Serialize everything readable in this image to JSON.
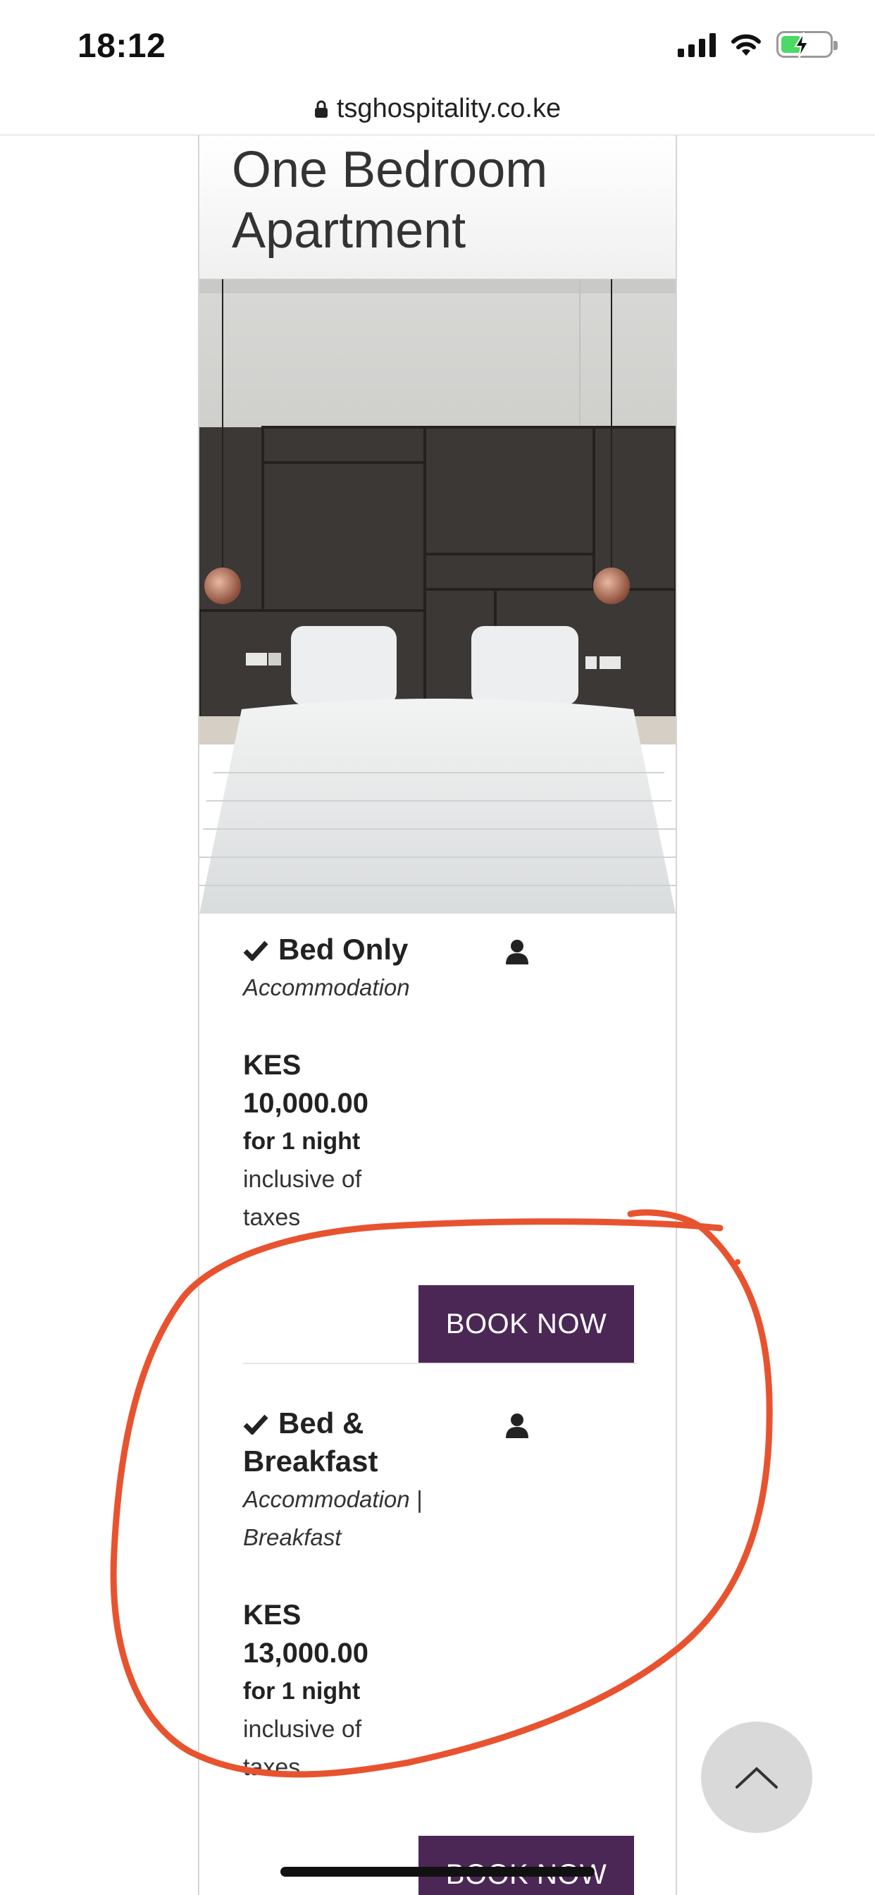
{
  "status_bar": {
    "time": "18:12",
    "icons": [
      "signal-icon",
      "wifi-icon",
      "battery-charging-icon"
    ],
    "battery_color": "#4cd964"
  },
  "browser": {
    "url": "tsghospitality.co.ke",
    "lock_icon": "lock-icon"
  },
  "room": {
    "title": "One Bedroom Apartment",
    "photo_alt": "bedroom-photo"
  },
  "rates": [
    {
      "name": "Bed Only",
      "includes": "Accommodation",
      "currency": "KES",
      "amount": "10,000.00",
      "nights": "for 1 night",
      "tax_note": "inclusive of taxes",
      "button": "BOOK NOW"
    },
    {
      "name": "Bed & Breakfast",
      "includes": "Accommodation | Breakfast",
      "currency": "KES",
      "amount": "13,000.00",
      "nights": "for 1 night",
      "tax_note": "inclusive of taxes",
      "button": "BOOK NOW"
    }
  ],
  "colors": {
    "button_bg": "#4b2755",
    "annotation": "#e8532f",
    "scroll_top_bg": "#d9d9d9"
  },
  "scroll_top_icon": "chevron-up-icon"
}
